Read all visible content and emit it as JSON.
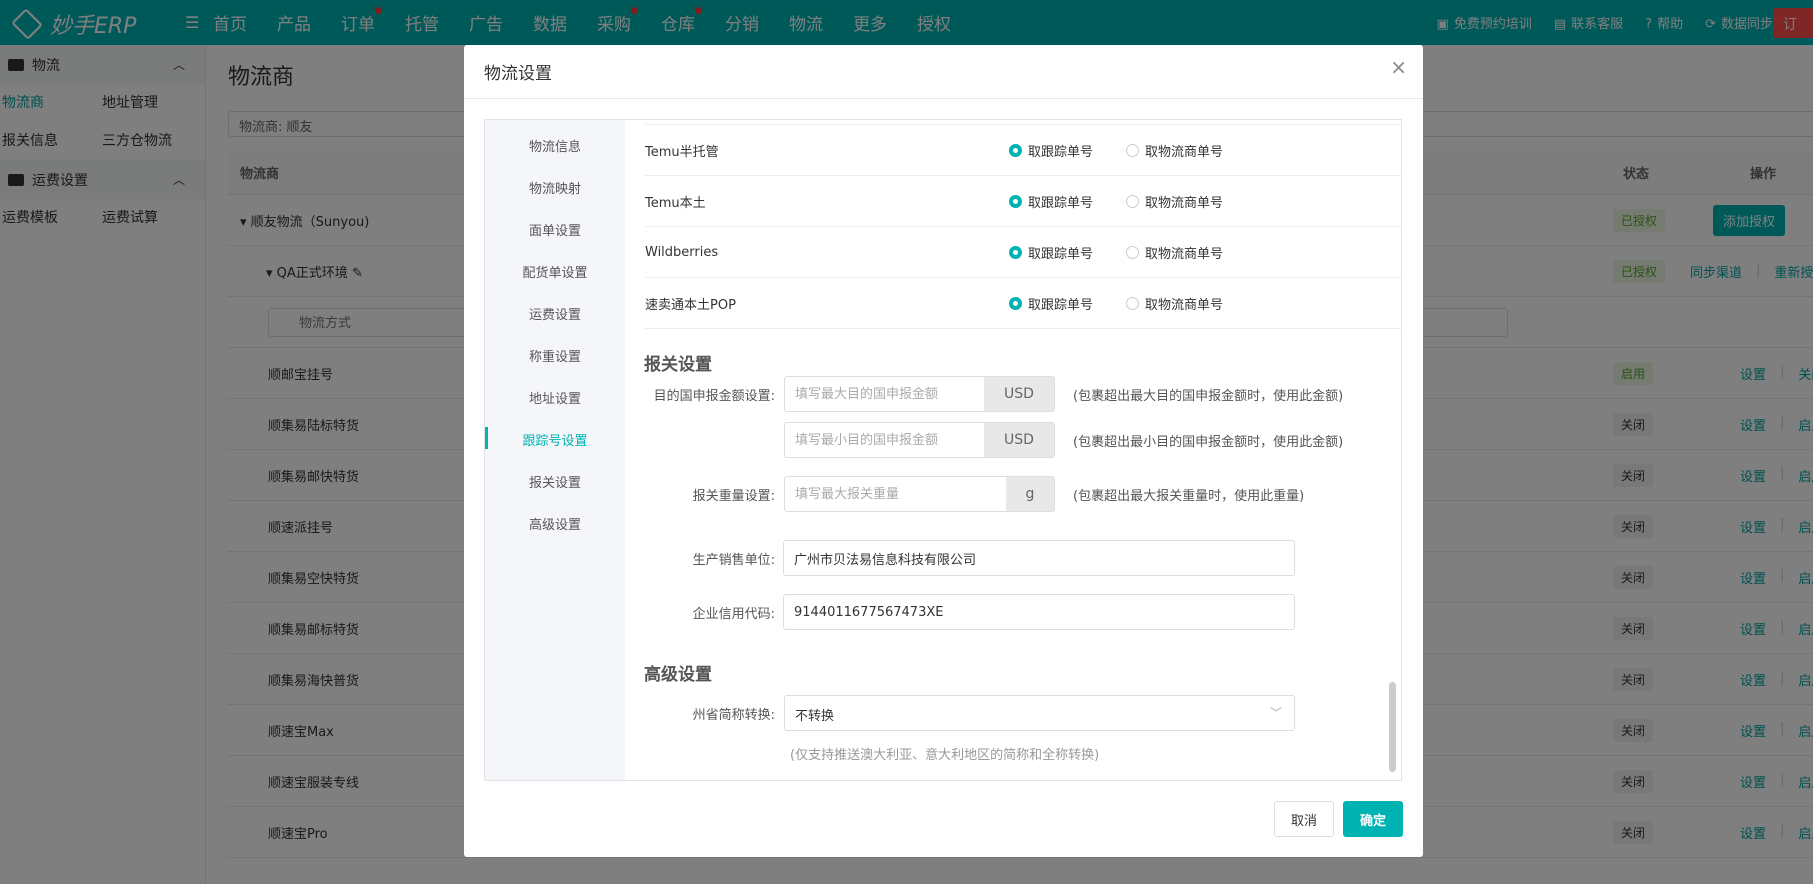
{
  "topbar": {
    "brand": "妙手ERP",
    "nav": [
      {
        "label": "首页",
        "dot": false
      },
      {
        "label": "产品",
        "dot": false
      },
      {
        "label": "订单",
        "dot": true
      },
      {
        "label": "托管",
        "dot": false
      },
      {
        "label": "广告",
        "dot": false
      },
      {
        "label": "数据",
        "dot": false
      },
      {
        "label": "采购",
        "dot": true
      },
      {
        "label": "仓库",
        "dot": true
      },
      {
        "label": "分销",
        "dot": false
      },
      {
        "label": "物流",
        "dot": false
      },
      {
        "label": "更多",
        "dot": false
      },
      {
        "label": "授权",
        "dot": false
      }
    ],
    "links": [
      "免费预约培训",
      "联系客服",
      "帮助",
      "数据同步"
    ],
    "order_btn": "订"
  },
  "sidebar": {
    "groups": [
      {
        "title": "物流",
        "items": [
          "物流商",
          "地址管理",
          "报关信息",
          "三方仓物流"
        ]
      },
      {
        "title": "运费设置",
        "items": [
          "运费模板",
          "运费试算"
        ]
      }
    ]
  },
  "main": {
    "title": "物流商",
    "filter": "物流商:  顺友",
    "cols": {
      "name": "物流商",
      "status": "状态",
      "ops": "操作"
    },
    "provider": {
      "name": "顺友物流（Sunyou)",
      "status": "已授权",
      "action": "添加授权"
    },
    "env": {
      "name": "QA正式环境",
      "status": "已授权",
      "ops": [
        "同步渠道",
        "重新授权"
      ]
    },
    "search_placeholder": "物流方式",
    "rows": [
      {
        "name": "顺邮宝挂号",
        "status": "启用",
        "ops": [
          "设置",
          "关闭"
        ]
      },
      {
        "name": "顺集易陆标特货",
        "status": "关闭",
        "ops": [
          "设置",
          "启用"
        ]
      },
      {
        "name": "顺集易邮快特货",
        "status": "关闭",
        "ops": [
          "设置",
          "启用"
        ]
      },
      {
        "name": "顺速派挂号",
        "status": "关闭",
        "ops": [
          "设置",
          "启用"
        ]
      },
      {
        "name": "顺集易空快特货",
        "status": "关闭",
        "ops": [
          "设置",
          "启用"
        ]
      },
      {
        "name": "顺集易邮标特货",
        "status": "关闭",
        "ops": [
          "设置",
          "启用"
        ]
      },
      {
        "name": "顺集易海快普货",
        "status": "关闭",
        "ops": [
          "设置",
          "启用"
        ]
      },
      {
        "name": "顺速宝Max",
        "status": "关闭",
        "ops": [
          "设置",
          "启用"
        ]
      },
      {
        "name": "顺速宝服装专线",
        "status": "关闭",
        "ops": [
          "设置",
          "启用"
        ]
      },
      {
        "name": "顺速宝Pro",
        "status": "关闭",
        "ops": [
          "设置",
          "启用"
        ]
      }
    ]
  },
  "modal": {
    "title": "物流设置",
    "nav": [
      "物流信息",
      "物流映射",
      "面单设置",
      "配货单设置",
      "运费设置",
      "称重设置",
      "地址设置",
      "跟踪号设置",
      "报关设置",
      "高级设置"
    ],
    "active_nav": 7,
    "platforms": [
      {
        "name": "Temu半托管",
        "opt1": "取跟踪单号",
        "opt2": "取物流商单号"
      },
      {
        "name": "Temu本土",
        "opt1": "取跟踪单号",
        "opt2": "取物流商单号"
      },
      {
        "name": "Wildberries",
        "opt1": "取跟踪单号",
        "opt2": "取物流商单号"
      },
      {
        "name": "速卖通本土POP",
        "opt1": "取跟踪单号",
        "opt2": "取物流商单号"
      }
    ],
    "customs": {
      "title": "报关设置",
      "amount_label": "目的国申报金额设置:",
      "max_placeholder": "填写最大目的国申报金额",
      "min_placeholder": "填写最小目的国申报金额",
      "currency": "USD",
      "max_hint": "(包裹超出最大目的国申报金额时，使用此金额)",
      "min_hint": "(包裹超出最小目的国申报金额时，使用此金额)",
      "weight_label": "报关重量设置:",
      "weight_placeholder": "填写最大报关重量",
      "weight_unit": "g",
      "weight_hint": "(包裹超出最大报关重量时，使用此重量)",
      "seller_label": "生产销售单位:",
      "seller_value": "广州市贝法易信息科技有限公司",
      "credit_label": "企业信用代码:",
      "credit_value": "9144011677567473XE"
    },
    "advanced": {
      "title": "高级设置",
      "state_label": "州省简称转换:",
      "state_value": "不转换",
      "state_hint": "(仅支持推送澳大利亚、意大利地区的简称和全称转换)"
    },
    "cancel": "取消",
    "confirm": "确定"
  }
}
